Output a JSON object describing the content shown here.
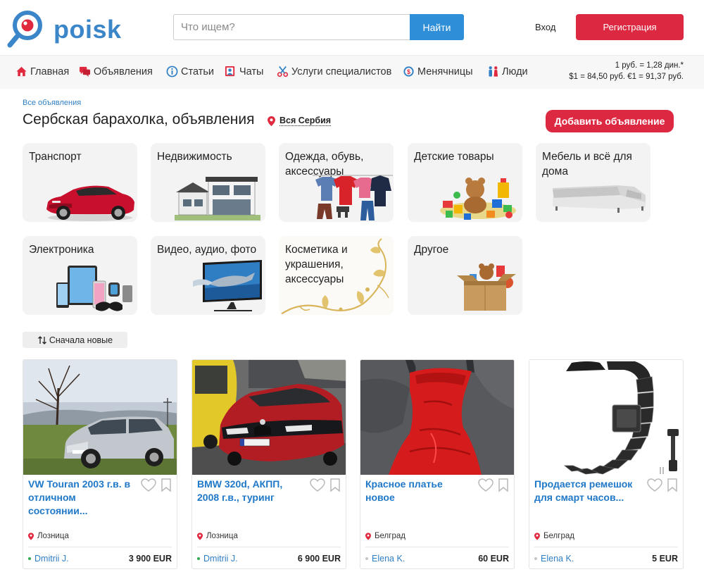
{
  "header": {
    "logo_text": "poisk",
    "search_placeholder": "Что ищем?",
    "search_button": "Найти",
    "login": "Вход",
    "register": "Регистрация"
  },
  "nav": {
    "items": [
      {
        "label": "Главная",
        "icon": "home-icon"
      },
      {
        "label": "Объявления",
        "icon": "ads-icon"
      },
      {
        "label": "Статьи",
        "icon": "info-icon"
      },
      {
        "label": "Чаты",
        "icon": "chat-icon"
      },
      {
        "label": "Услуги специалистов",
        "icon": "scissors-icon"
      },
      {
        "label": "Менячницы",
        "icon": "exchange-icon"
      },
      {
        "label": "Люди",
        "icon": "people-icon"
      }
    ],
    "rates": {
      "line1": "1 руб. = 1,28 дин.*",
      "line2": "$1 = 84,50 руб. €1 = 91,37 руб."
    }
  },
  "content": {
    "breadcrumb": "Все объявления",
    "title": "Сербская барахолка, объявления",
    "region": "Вся Сербия",
    "add_button": "Добавить объявление"
  },
  "categories": [
    {
      "label": "Транспорт"
    },
    {
      "label": "Недвижимость"
    },
    {
      "label": "Одежда, обувь, аксессуары"
    },
    {
      "label": "Детские товары"
    },
    {
      "label": "Мебель и всё для дома"
    },
    {
      "label": "Электроника"
    },
    {
      "label": "Видео, аудио, фото"
    },
    {
      "label": "Косметика и украшения, аксессуары"
    },
    {
      "label": "Другое"
    }
  ],
  "sort": {
    "label": "Сначала новые",
    "icon": "sort-arrows-icon"
  },
  "listings": [
    {
      "title": "VW Touran 2003 г.в. в отличном состоянии...",
      "city": "Лозница",
      "seller": "Dmitrii J.",
      "price": "3 900 EUR",
      "seller_status_color": "#2eae4f"
    },
    {
      "title": "BMW 320d, АКПП, 2008 г.в., туринг",
      "city": "Лозница",
      "seller": "Dmitrii J.",
      "price": "6 900 EUR",
      "seller_status_color": "#2eae4f"
    },
    {
      "title": "Красное платье новое",
      "city": "Белград",
      "seller": "Elena K.",
      "price": "60 EUR",
      "seller_status_color": "#c4c4c4"
    },
    {
      "title": "Продается ремешок для смарт часов...",
      "city": "Белград",
      "seller": "Elena K.",
      "price": "5 EUR",
      "seller_status_color": "#c4c4c4"
    }
  ],
  "colors": {
    "brand_blue": "#2f8ed8",
    "brand_red": "#dc2840",
    "link_blue": "#1f78c8"
  }
}
